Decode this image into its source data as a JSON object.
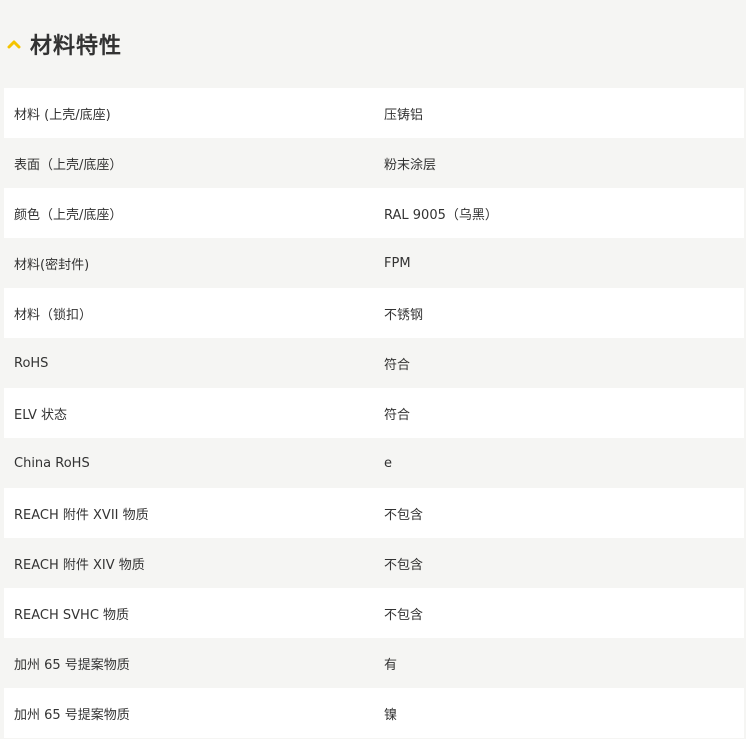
{
  "section": {
    "title": "材料特性",
    "toggle_icon": "chevron-up-icon",
    "accent_color": "#f5c400"
  },
  "properties": [
    {
      "label": "材料 (上壳/底座)",
      "value": "压铸铝"
    },
    {
      "label": "表面（上壳/底座）",
      "value": "粉末涂层"
    },
    {
      "label": "颜色（上壳/底座）",
      "value": "RAL 9005（乌黑）"
    },
    {
      "label": "材料(密封件)",
      "value": "FPM"
    },
    {
      "label": "材料（锁扣）",
      "value": "不锈钢"
    },
    {
      "label": "RoHS",
      "value": "符合"
    },
    {
      "label": "ELV 状态",
      "value": "符合"
    },
    {
      "label": "China RoHS",
      "value": "e"
    },
    {
      "label": "REACH 附件 XVII 物质",
      "value": "不包含"
    },
    {
      "label": "REACH 附件 XIV 物质",
      "value": "不包含"
    },
    {
      "label": "REACH SVHC 物质",
      "value": "不包含"
    },
    {
      "label": "加州 65 号提案物质",
      "value": "有"
    },
    {
      "label": "加州 65 号提案物质",
      "value": "镍"
    }
  ]
}
